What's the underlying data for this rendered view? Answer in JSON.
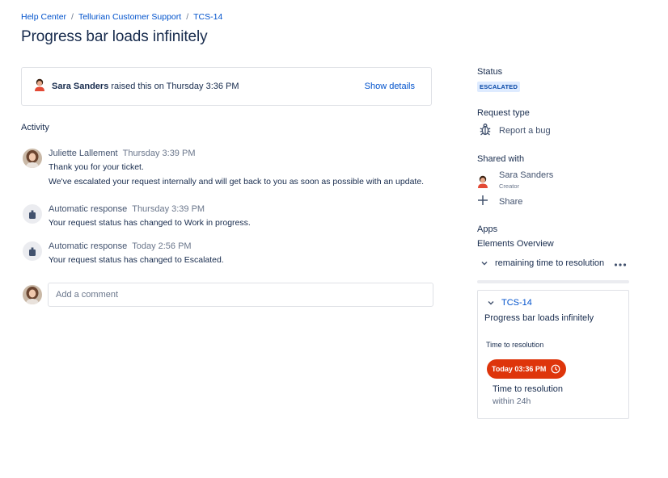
{
  "breadcrumb": {
    "items": [
      "Help Center",
      "Tellurian Customer Support",
      "TCS-14"
    ],
    "separator": "/"
  },
  "page_title": "Progress bar loads infinitely",
  "raised": {
    "reporter": "Sara Sanders",
    "text": " raised this on Thursday 3:36 PM",
    "show_details": "Show details"
  },
  "activity": {
    "heading": "Activity",
    "items": [
      {
        "author": "Juliette Lallement",
        "time": "Thursday 3:39 PM",
        "lines": [
          "Thank you for your ticket.",
          "We've escalated your request internally and will get back to you as soon as possible with an update."
        ],
        "avatar": "user-avatar"
      },
      {
        "author": "Automatic response",
        "time": "Thursday 3:39 PM",
        "lines": [
          "Your request status has changed to Work in progress."
        ],
        "avatar": "bot-icon"
      },
      {
        "author": "Automatic response",
        "time": "Today 2:56 PM",
        "lines": [
          "Your request status has changed to Escalated."
        ],
        "avatar": "bot-icon"
      }
    ]
  },
  "comment": {
    "placeholder": "Add a comment"
  },
  "sidebar": {
    "status_label": "Status",
    "status_value": "ESCALATED",
    "request_type_label": "Request type",
    "request_type_value": "Report a bug",
    "shared_with_label": "Shared with",
    "shared_user": "Sara Sanders",
    "shared_user_role": "Creator",
    "share_label": "Share",
    "apps_label": "Apps",
    "elements_overview_label": "Elements Overview",
    "elements_toggle_label": "remaining time to resolution",
    "panel": {
      "issue_key": "TCS-14",
      "summary": "Progress bar loads infinitely",
      "ttr_label": "Time to resolution",
      "sla_badge": "Today 03:36 PM",
      "goal_name": "Time to resolution",
      "goal_target": "within 24h"
    }
  },
  "colors": {
    "link": "#0052cc",
    "text": "#172b4d",
    "status_badge_bg": "#deebff",
    "status_badge_text": "#0747a6",
    "sla_breached": "#de350b"
  }
}
